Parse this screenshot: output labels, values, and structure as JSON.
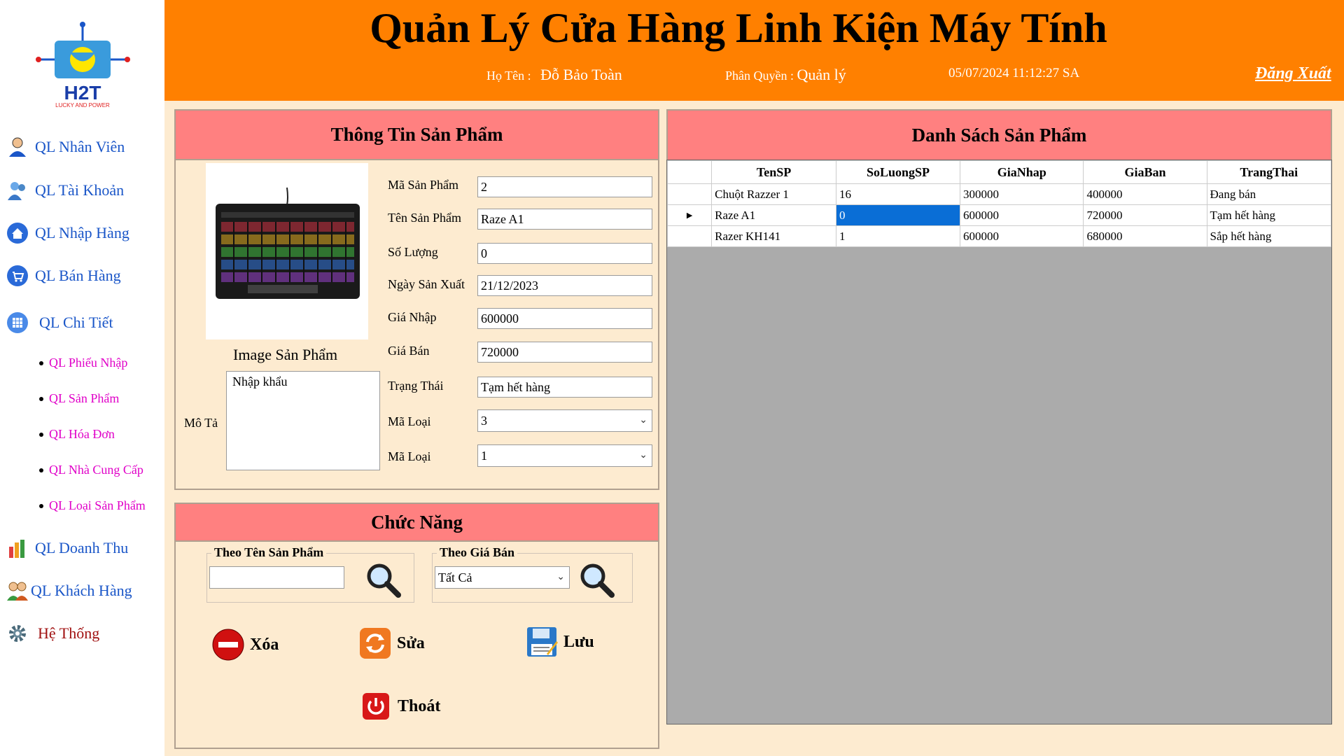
{
  "logo": {
    "text": "H2T",
    "tagline": "LUCKY AND POWER"
  },
  "header": {
    "title": "Quản Lý Cửa Hàng Linh Kiện Máy Tính",
    "name_label": "Họ Tên :",
    "name_value": "Đỗ Bảo Toàn",
    "role_label": "Phân Quyền :",
    "role_value": "Quản lý",
    "datetime": "05/07/2024 11:12:27 SA",
    "logout": "Đăng Xuất"
  },
  "sidebar": {
    "items": [
      {
        "label": "QL Nhân Viên",
        "icon": "employee-icon"
      },
      {
        "label": "QL Tài Khoản",
        "icon": "account-icon"
      },
      {
        "label": "QL Nhập Hàng",
        "icon": "home-icon"
      },
      {
        "label": "QL Bán Hàng",
        "icon": "cart-icon"
      },
      {
        "label": "QL Chi Tiết",
        "icon": "grid-icon"
      }
    ],
    "subitems": [
      "QL Phiếu Nhập",
      "QL Sản Phẩm",
      "QL Hóa Đơn",
      "QL Nhà Cung Cấp",
      "QL Loại Sản Phẩm"
    ],
    "bottom_items": [
      {
        "label": "QL Doanh Thu",
        "icon": "revenue-icon"
      },
      {
        "label": "QL Khách Hàng",
        "icon": "customers-icon"
      },
      {
        "label": "Hệ Thống",
        "icon": "gear-icon"
      }
    ]
  },
  "product_info": {
    "title": "Thông Tin Sản Phẩm",
    "image_label": "Image Sản Phẩm",
    "desc_label": "Mô Tả",
    "desc_value": "Nhập khẩu",
    "fields": {
      "ma_sp": {
        "label": "Mã Sản Phẩm",
        "value": "2"
      },
      "ten_sp": {
        "label": "Tên Sản Phẩm",
        "value": "Raze A1"
      },
      "so_luong": {
        "label": "Số Lượng",
        "value": "0"
      },
      "ngay_sx": {
        "label": "Ngày Sản Xuất",
        "value": "21/12/2023"
      },
      "gia_nhap": {
        "label": "Giá Nhập",
        "value": "600000"
      },
      "gia_ban": {
        "label": "Giá Bán",
        "value": "720000"
      },
      "trang_thai": {
        "label": "Trạng Thái",
        "value": "Tạm hết hàng"
      },
      "ma_loai_1": {
        "label": "Mã Loại",
        "value": "3"
      },
      "ma_loai_2": {
        "label": "Mã Loại",
        "value": "1"
      }
    }
  },
  "functions": {
    "title": "Chức Năng",
    "search_name_label": "Theo Tên Sản Phẩm",
    "search_name_value": "",
    "search_price_label": "Theo Giá Bán",
    "search_price_value": "Tất Cả",
    "delete": "Xóa",
    "edit": "Sửa",
    "save": "Lưu",
    "exit": "Thoát"
  },
  "product_list": {
    "title": "Danh Sách Sản Phẩm",
    "columns": [
      "TenSP",
      "SoLuongSP",
      "GiaNhap",
      "GiaBan",
      "TrangThai"
    ],
    "rows": [
      [
        "Chuột Razzer 1",
        "16",
        "300000",
        "400000",
        "Đang bán"
      ],
      [
        "Raze A1",
        "0",
        "600000",
        "720000",
        "Tạm hết hàng"
      ],
      [
        "Razer KH141",
        "1",
        "600000",
        "680000",
        "Sắp hết hàng"
      ]
    ],
    "selected_row": 1,
    "selected_col": 1
  },
  "colors": {
    "header_bg": "#ff8000",
    "panel_title_bg": "#ff8080",
    "content_bg": "#fdebd0",
    "nav_text": "#1a56c8",
    "subnav_text": "#e000c8"
  }
}
